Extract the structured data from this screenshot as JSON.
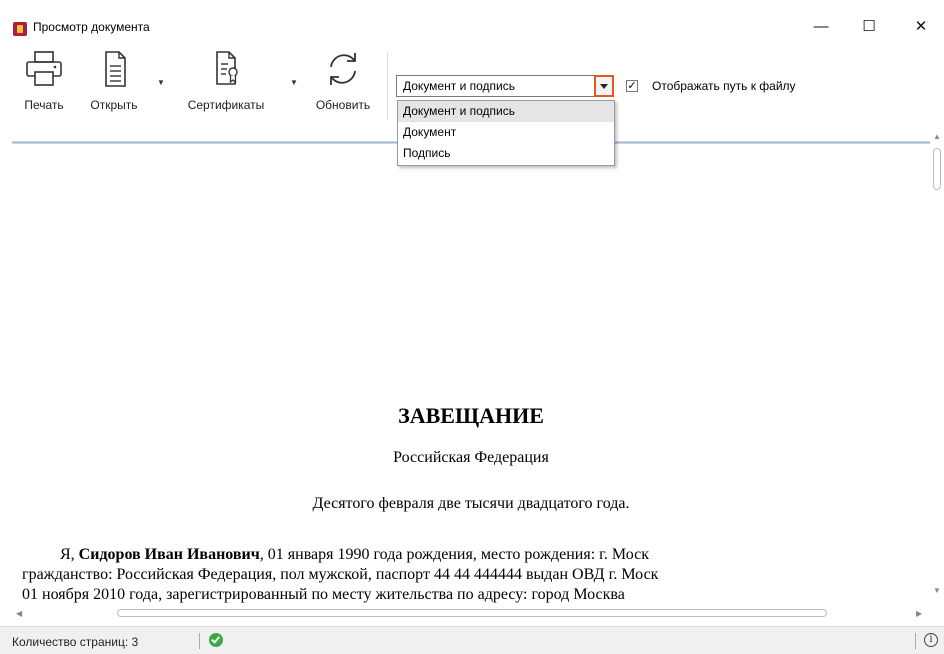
{
  "window": {
    "title": "Просмотр документа",
    "controls": {
      "minimize": "—",
      "maximize": "☐",
      "close": "✕"
    }
  },
  "toolbar": {
    "print_label": "Печать",
    "open_label": "Открыть",
    "certificates_label": "Сертификаты",
    "refresh_label": "Обновить",
    "view_mode": {
      "selected": "Документ и подпись",
      "options": [
        "Документ и подпись",
        "Документ",
        "Подпись"
      ]
    },
    "show_path": {
      "checked": true,
      "label": "Отображать путь к файлу"
    }
  },
  "document": {
    "title": "ЗАВЕЩАНИЕ",
    "subtitle": "Российская Федерация",
    "date_line": "Десятого февраля две тысячи двадцатого года.",
    "body_line1_prefix": "Я, ",
    "body_line1_name": "Сидоров Иван Иванович",
    "body_line1_rest": ", 01 января 1990 года рождения, место рождения: г. Моск",
    "body_line2": "гражданство: Российская Федерация, пол мужской, паспорт 44 44 444444 выдан ОВД г. Моск",
    "body_line3": "01 ноября 2010 года, зарегистрированный по месту жительства по адресу: город Москва"
  },
  "status": {
    "page_count": "Количество страниц: 3",
    "signature_ok": true
  },
  "colors": {
    "accent_orange": "#e2591d",
    "ok_green": "#39a845",
    "app_icon": "#b01e3c"
  }
}
